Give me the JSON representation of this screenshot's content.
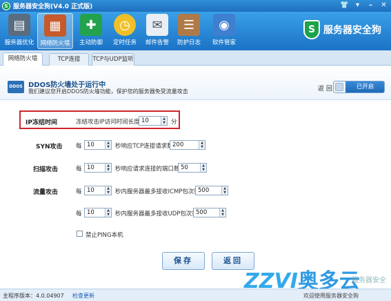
{
  "window": {
    "title": "服务器安全狗(V4.0 正式版)"
  },
  "toolbar": {
    "items": [
      {
        "label": "服务器优化",
        "icon": "server-optimize-icon"
      },
      {
        "label": "网络防火墙",
        "icon": "firewall-icon"
      },
      {
        "label": "主动防御",
        "icon": "shield-icon"
      },
      {
        "label": "定时任务",
        "icon": "clock-icon"
      },
      {
        "label": "邮件告警",
        "icon": "mail-icon"
      },
      {
        "label": "防护日志",
        "icon": "log-icon"
      },
      {
        "label": "软件管家",
        "icon": "software-icon"
      }
    ],
    "brand": "服务器安全狗"
  },
  "tabs": [
    {
      "label": "网络防火墙"
    },
    {
      "label": "TCP连接"
    },
    {
      "label": "TCP与UDP监听"
    }
  ],
  "banner": {
    "logo": "DDOS",
    "title": "DDOS防火墙处于运行中",
    "desc": "我们建议您开启DDOS防火墙功能，保护您的服务器免受流量攻击",
    "close_label": "返 回",
    "toggle_label": "已开启"
  },
  "form": {
    "ip_freeze": {
      "label": "IP冻结时间",
      "desc": "冻结攻击IP访问时间长度",
      "value": "10",
      "unit": "分"
    },
    "syn": {
      "label": "SYN攻击",
      "prefix": "每",
      "interval": "10",
      "desc": "秒响应TCP连接请求数",
      "value": "200"
    },
    "scan": {
      "label": "扫描攻击",
      "prefix": "每",
      "interval": "10",
      "desc": "秒响应请求连接的端口数",
      "value": "50"
    },
    "flow": {
      "label": "流量攻击",
      "icmp": {
        "prefix": "每",
        "interval": "10",
        "desc": "秒内服务器最多接收ICMP包次数",
        "value": "500"
      },
      "udp": {
        "prefix": "每",
        "interval": "10",
        "desc": "秒内服务器最多接收UDP包次数",
        "value": "500"
      }
    },
    "ping": {
      "label": "禁止PING本机"
    }
  },
  "buttons": {
    "save": "保存",
    "back": "返回"
  },
  "statusbar": {
    "version": "主程序版本：4.0.04907",
    "update": "检查更新",
    "protect": "欢迎使用服务器安全狗"
  },
  "watermark": {
    "latin": "ZZVI",
    "cn": "奥多云",
    "small": "服务器安全"
  }
}
